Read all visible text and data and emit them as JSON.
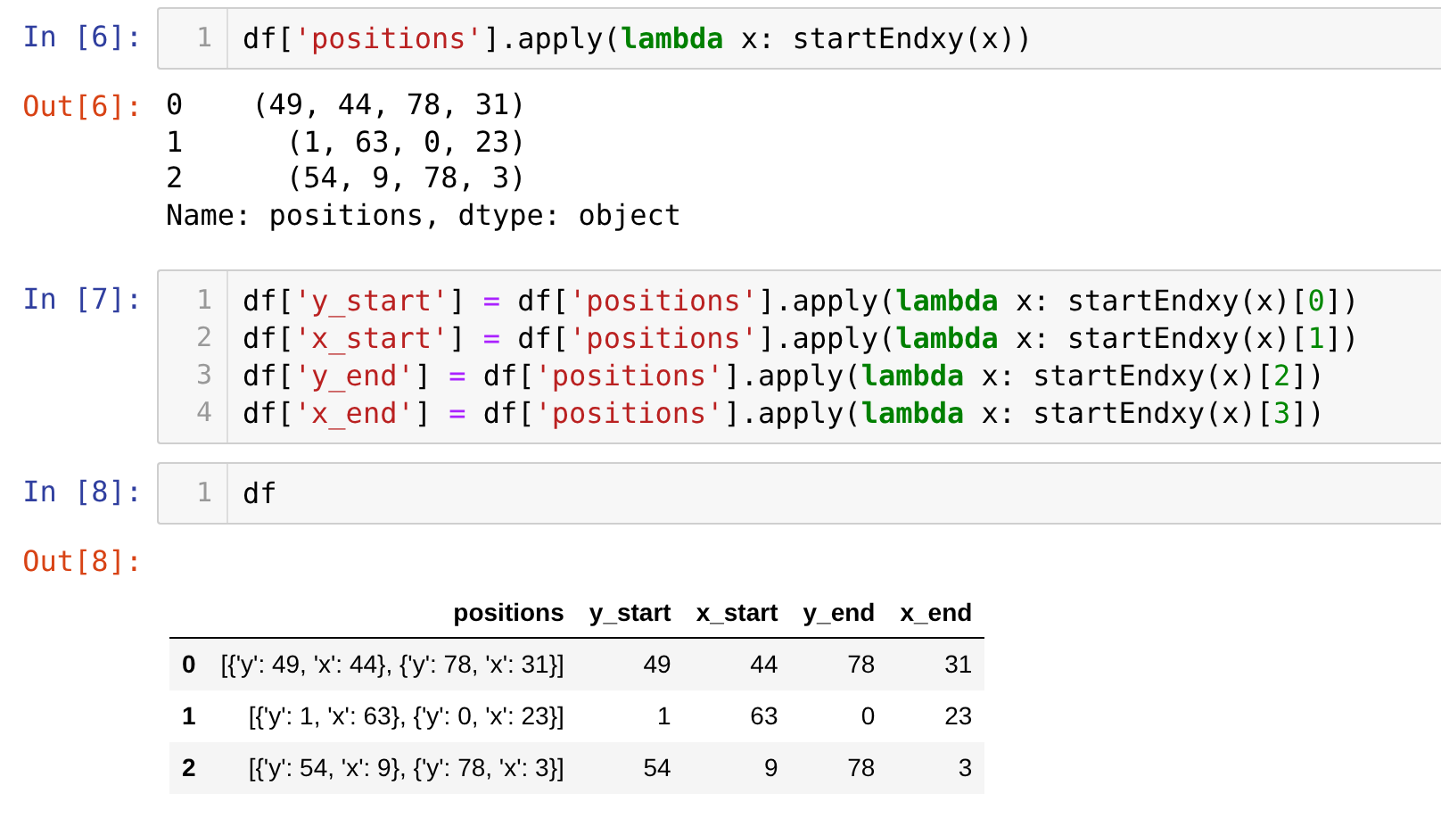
{
  "cells": [
    {
      "kind": "code",
      "prompt": "In [6]:",
      "lines": [
        {
          "number": "1",
          "tokens": [
            {
              "kind": "plain",
              "text": "df["
            },
            {
              "kind": "string",
              "text": "'positions'"
            },
            {
              "kind": "plain",
              "text": "].apply("
            },
            {
              "kind": "keyword",
              "text": "lambda"
            },
            {
              "kind": "plain",
              "text": " x: startEndxy(x))"
            }
          ]
        }
      ]
    },
    {
      "kind": "text_output",
      "prompt": "Out[6]:",
      "lines": [
        "0    (49, 44, 78, 31)",
        "1      (1, 63, 0, 23)",
        "2      (54, 9, 78, 3)",
        "Name: positions, dtype: object"
      ]
    },
    {
      "kind": "code",
      "prompt": "In [7]:",
      "lines": [
        {
          "number": "1",
          "tokens": [
            {
              "kind": "plain",
              "text": "df["
            },
            {
              "kind": "string",
              "text": "'y_start'"
            },
            {
              "kind": "plain",
              "text": "] "
            },
            {
              "kind": "operator",
              "text": "="
            },
            {
              "kind": "plain",
              "text": " df["
            },
            {
              "kind": "string",
              "text": "'positions'"
            },
            {
              "kind": "plain",
              "text": "].apply("
            },
            {
              "kind": "keyword",
              "text": "lambda"
            },
            {
              "kind": "plain",
              "text": " x: startEndxy(x)["
            },
            {
              "kind": "number",
              "text": "0"
            },
            {
              "kind": "plain",
              "text": "])"
            }
          ]
        },
        {
          "number": "2",
          "tokens": [
            {
              "kind": "plain",
              "text": "df["
            },
            {
              "kind": "string",
              "text": "'x_start'"
            },
            {
              "kind": "plain",
              "text": "] "
            },
            {
              "kind": "operator",
              "text": "="
            },
            {
              "kind": "plain",
              "text": " df["
            },
            {
              "kind": "string",
              "text": "'positions'"
            },
            {
              "kind": "plain",
              "text": "].apply("
            },
            {
              "kind": "keyword",
              "text": "lambda"
            },
            {
              "kind": "plain",
              "text": " x: startEndxy(x)["
            },
            {
              "kind": "number",
              "text": "1"
            },
            {
              "kind": "plain",
              "text": "])"
            }
          ]
        },
        {
          "number": "3",
          "tokens": [
            {
              "kind": "plain",
              "text": "df["
            },
            {
              "kind": "string",
              "text": "'y_end'"
            },
            {
              "kind": "plain",
              "text": "] "
            },
            {
              "kind": "operator",
              "text": "="
            },
            {
              "kind": "plain",
              "text": " df["
            },
            {
              "kind": "string",
              "text": "'positions'"
            },
            {
              "kind": "plain",
              "text": "].apply("
            },
            {
              "kind": "keyword",
              "text": "lambda"
            },
            {
              "kind": "plain",
              "text": " x: startEndxy(x)["
            },
            {
              "kind": "number",
              "text": "2"
            },
            {
              "kind": "plain",
              "text": "])"
            }
          ]
        },
        {
          "number": "4",
          "tokens": [
            {
              "kind": "plain",
              "text": "df["
            },
            {
              "kind": "string",
              "text": "'x_end'"
            },
            {
              "kind": "plain",
              "text": "] "
            },
            {
              "kind": "operator",
              "text": "="
            },
            {
              "kind": "plain",
              "text": " df["
            },
            {
              "kind": "string",
              "text": "'positions'"
            },
            {
              "kind": "plain",
              "text": "].apply("
            },
            {
              "kind": "keyword",
              "text": "lambda"
            },
            {
              "kind": "plain",
              "text": " x: startEndxy(x)["
            },
            {
              "kind": "number",
              "text": "3"
            },
            {
              "kind": "plain",
              "text": "])"
            }
          ]
        }
      ]
    },
    {
      "kind": "code",
      "prompt": "In [8]:",
      "lines": [
        {
          "number": "1",
          "tokens": [
            {
              "kind": "plain",
              "text": "df"
            }
          ]
        }
      ]
    },
    {
      "kind": "table_output",
      "prompt": "Out[8]:",
      "columns": [
        "positions",
        "y_start",
        "x_start",
        "y_end",
        "x_end"
      ],
      "rows": [
        {
          "index": "0",
          "cells": [
            "[{'y': 49, 'x': 44}, {'y': 78, 'x': 31}]",
            "49",
            "44",
            "78",
            "31"
          ]
        },
        {
          "index": "1",
          "cells": [
            "[{'y': 1, 'x': 63}, {'y': 0, 'x': 23}]",
            "1",
            "63",
            "0",
            "23"
          ]
        },
        {
          "index": "2",
          "cells": [
            "[{'y': 54, 'x': 9}, {'y': 78, 'x': 3}]",
            "54",
            "9",
            "78",
            "3"
          ]
        }
      ]
    }
  ]
}
